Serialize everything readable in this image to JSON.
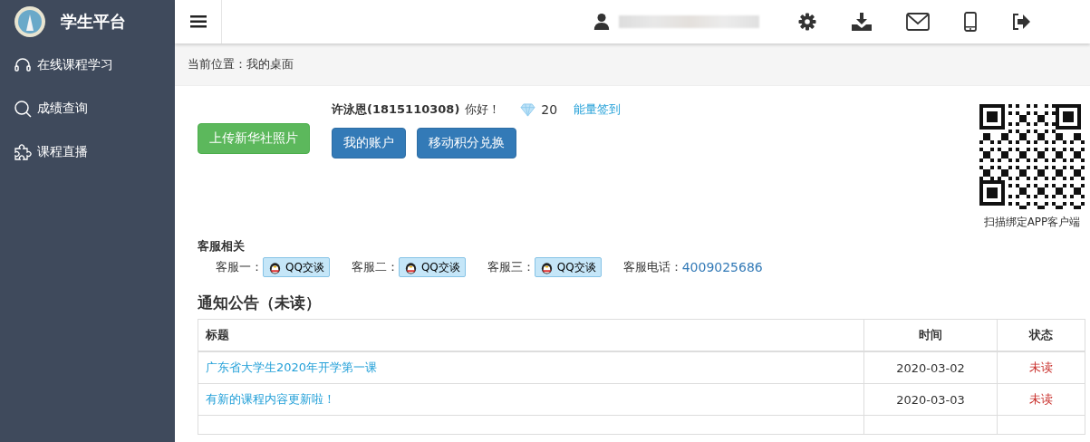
{
  "sidebar": {
    "title": "学生平台",
    "items": [
      {
        "label": "在线课程学习"
      },
      {
        "label": "成绩查询"
      },
      {
        "label": "课程直播"
      }
    ]
  },
  "breadcrumb": "当前位置：我的桌面",
  "profile": {
    "name": "许泳恩(1815110308)",
    "greeting": "你好！",
    "points": "20",
    "checkin_link": "能量签到"
  },
  "buttons": {
    "upload": "上传新华社照片",
    "account": "我的账户",
    "exchange": "移动积分兑换"
  },
  "qr": {
    "caption": "扫描绑定APP客户端"
  },
  "service": {
    "title": "客服相关",
    "agents": [
      {
        "label": "客服一：",
        "button": "QQ交谈"
      },
      {
        "label": "客服二：",
        "button": "QQ交谈"
      },
      {
        "label": "客服三：",
        "button": "QQ交谈"
      }
    ],
    "phone_label": "客服电话：",
    "phone": "4009025686"
  },
  "notices": {
    "title": "通知公告（未读）",
    "columns": [
      "标题",
      "时间",
      "状态"
    ],
    "rows": [
      {
        "title": "广东省大学生2020年开学第一课",
        "date": "2020-03-02",
        "status": "未读",
        "read": false
      },
      {
        "title": "有新的课程内容更新啦！",
        "date": "2020-03-03",
        "status": "未读",
        "read": false
      }
    ]
  }
}
